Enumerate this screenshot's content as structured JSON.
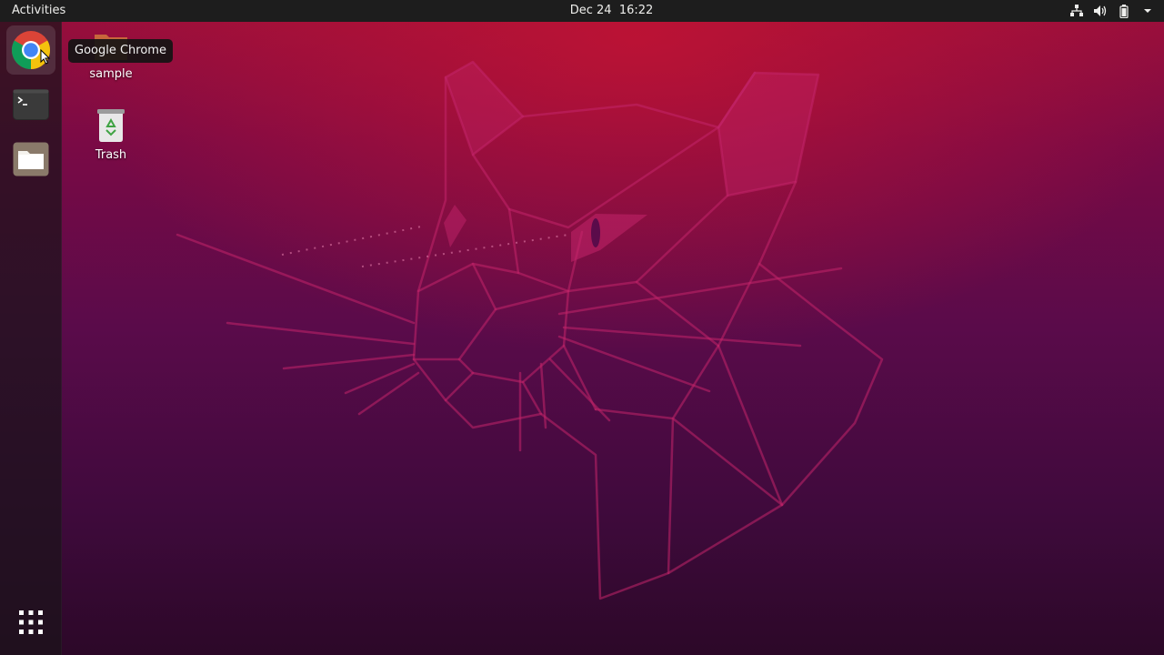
{
  "topbar": {
    "activities_label": "Activities",
    "clock_text": "Dec 24  16:22",
    "tray_icons": [
      "network-icon",
      "volume-icon",
      "battery-icon",
      "system-menu-arrow-icon"
    ]
  },
  "dock": {
    "items": [
      {
        "name": "Google Chrome",
        "icon": "chrome-icon",
        "hovered": true
      },
      {
        "name": "Terminal",
        "icon": "terminal-icon"
      },
      {
        "name": "Files",
        "icon": "files-icon"
      }
    ],
    "show_apps_icon": "app-grid-icon",
    "tooltip": "Google Chrome"
  },
  "desktop": {
    "icons": [
      {
        "label": "sample",
        "icon": "folder-icon"
      },
      {
        "label": "Trash",
        "icon": "trash-icon"
      }
    ]
  },
  "colors": {
    "topbar_bg": "#1d1d1d",
    "wallpaper_top": "#9c0f3a",
    "wallpaper_bottom": "#2c0828",
    "accent": "#e95420"
  }
}
